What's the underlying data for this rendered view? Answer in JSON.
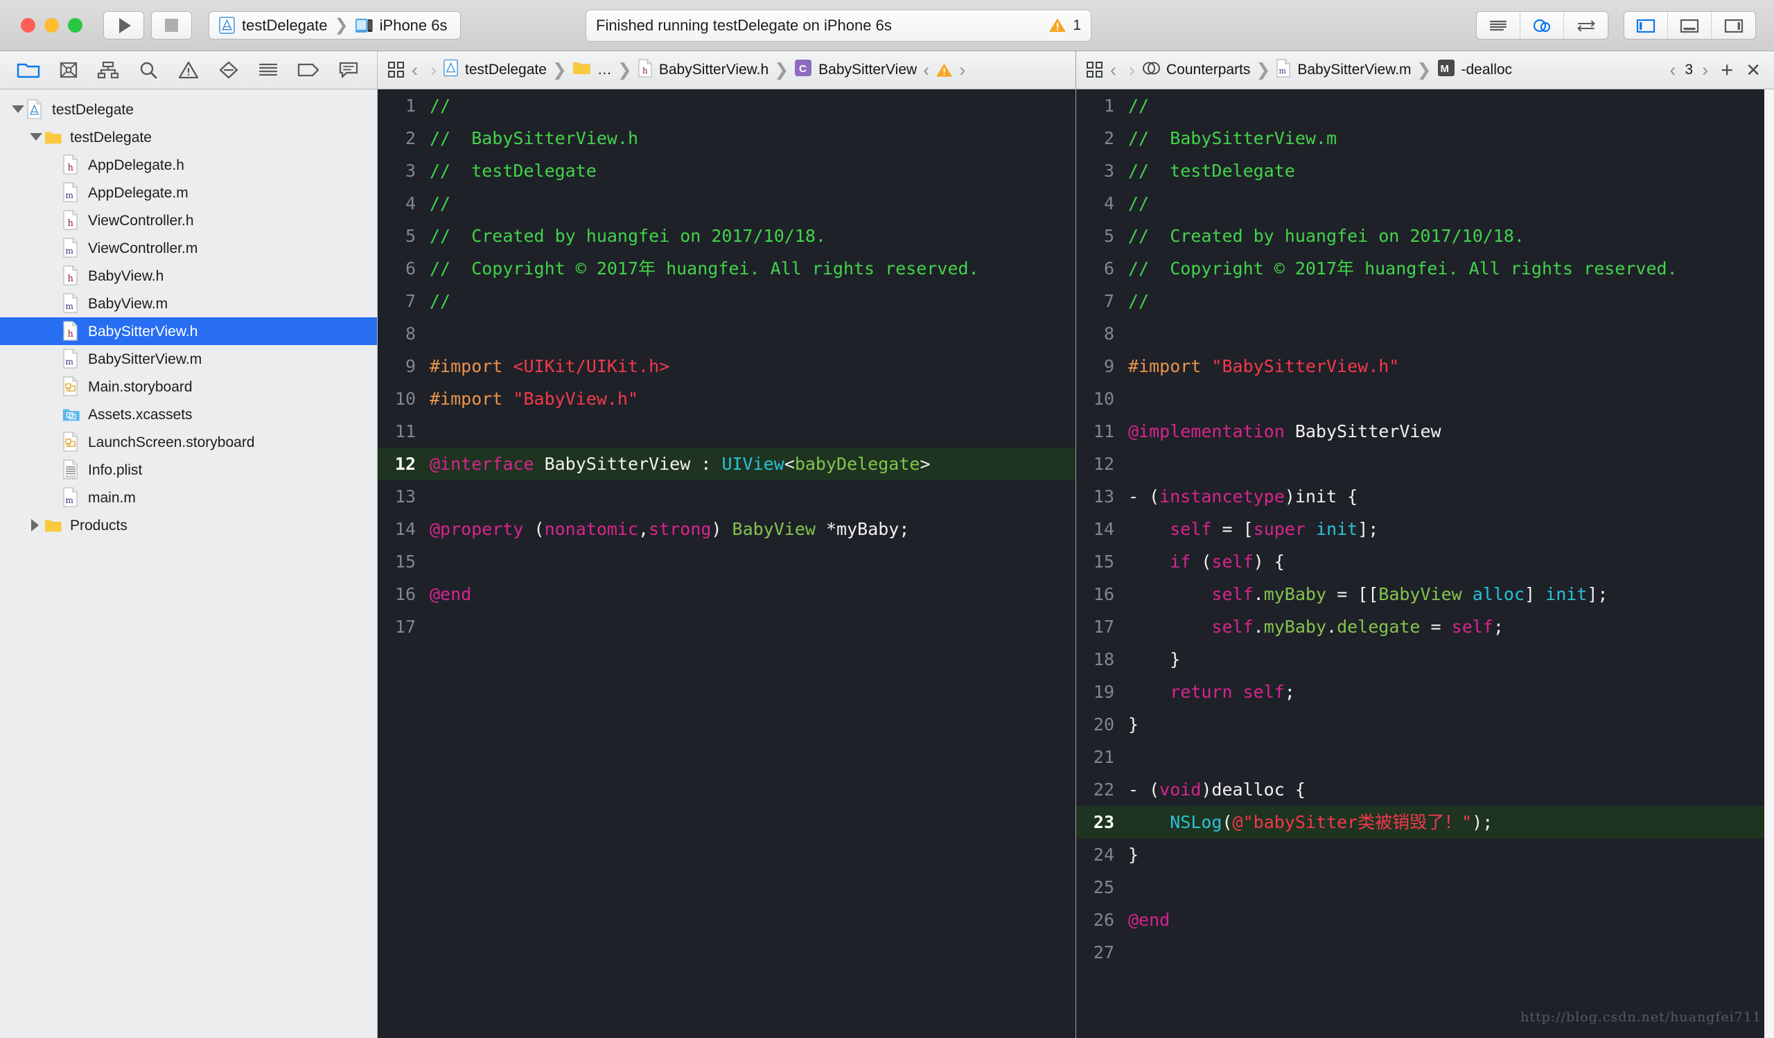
{
  "window": {
    "traffic_lights": [
      "close",
      "minimize",
      "zoom"
    ],
    "run_button": "run",
    "stop_button": "stop",
    "scheme": {
      "project": "testDelegate",
      "destination": "iPhone 6s"
    },
    "status": {
      "message": "Finished running testDelegate on iPhone 6s",
      "warning_count": "1"
    },
    "editor_modes": [
      "standard-editor",
      "assistant-editor",
      "version-editor"
    ],
    "view_toggles": [
      "navigator-toggle",
      "debug-area-toggle",
      "utilities-toggle"
    ]
  },
  "navigator": {
    "tabs": [
      "project-navigator",
      "source-control-navigator",
      "symbol-navigator",
      "find-navigator",
      "issue-navigator",
      "test-navigator",
      "debug-navigator",
      "breakpoint-navigator",
      "report-navigator"
    ],
    "tree": [
      {
        "label": "testDelegate",
        "icon": "xcodeproj",
        "indent": 0,
        "twisty": "open",
        "selected": false
      },
      {
        "label": "testDelegate",
        "icon": "folder",
        "indent": 1,
        "twisty": "open",
        "selected": false
      },
      {
        "label": "AppDelegate.h",
        "icon": "header",
        "indent": 2,
        "twisty": "none",
        "selected": false
      },
      {
        "label": "AppDelegate.m",
        "icon": "method",
        "indent": 2,
        "twisty": "none",
        "selected": false
      },
      {
        "label": "ViewController.h",
        "icon": "header",
        "indent": 2,
        "twisty": "none",
        "selected": false
      },
      {
        "label": "ViewController.m",
        "icon": "method",
        "indent": 2,
        "twisty": "none",
        "selected": false
      },
      {
        "label": "BabyView.h",
        "icon": "header",
        "indent": 2,
        "twisty": "none",
        "selected": false
      },
      {
        "label": "BabyView.m",
        "icon": "method",
        "indent": 2,
        "twisty": "none",
        "selected": false
      },
      {
        "label": "BabySitterView.h",
        "icon": "header",
        "indent": 2,
        "twisty": "none",
        "selected": true
      },
      {
        "label": "BabySitterView.m",
        "icon": "method",
        "indent": 2,
        "twisty": "none",
        "selected": false
      },
      {
        "label": "Main.storyboard",
        "icon": "storyboard",
        "indent": 2,
        "twisty": "none",
        "selected": false
      },
      {
        "label": "Assets.xcassets",
        "icon": "xcassets",
        "indent": 2,
        "twisty": "none",
        "selected": false
      },
      {
        "label": "LaunchScreen.storyboard",
        "icon": "storyboard",
        "indent": 2,
        "twisty": "none",
        "selected": false
      },
      {
        "label": "Info.plist",
        "icon": "plist",
        "indent": 2,
        "twisty": "none",
        "selected": false
      },
      {
        "label": "main.m",
        "icon": "method",
        "indent": 2,
        "twisty": "none",
        "selected": false
      },
      {
        "label": "Products",
        "icon": "folder",
        "indent": 1,
        "twisty": "closed",
        "selected": false
      }
    ]
  },
  "left_editor": {
    "jumpbar": {
      "related_items": "related-items",
      "back": "‹",
      "forward": "›",
      "crumbs": [
        {
          "label": "testDelegate",
          "icon": "xcodeproj"
        },
        {
          "label": "…",
          "icon": "folder"
        },
        {
          "label": "BabySitterView.h",
          "icon": "header"
        },
        {
          "label": "BabySitterView",
          "icon": "class-c"
        }
      ],
      "issue_prev": "‹",
      "issue_next": "›",
      "issue_badge": "warning"
    },
    "lines": [
      {
        "n": "1",
        "hl": false,
        "spans": [
          {
            "t": "//",
            "c": "cmt"
          }
        ]
      },
      {
        "n": "2",
        "hl": false,
        "spans": [
          {
            "t": "//  BabySitterView.h",
            "c": "cmt"
          }
        ]
      },
      {
        "n": "3",
        "hl": false,
        "spans": [
          {
            "t": "//  testDelegate",
            "c": "cmt"
          }
        ]
      },
      {
        "n": "4",
        "hl": false,
        "spans": [
          {
            "t": "//",
            "c": "cmt"
          }
        ]
      },
      {
        "n": "5",
        "hl": false,
        "spans": [
          {
            "t": "//  Created by huangfei on 2017/10/18.",
            "c": "cmt"
          }
        ]
      },
      {
        "n": "6",
        "hl": false,
        "spans": [
          {
            "t": "//  Copyright © 2017年 huangfei. All rights reserved.",
            "c": "cmt"
          }
        ]
      },
      {
        "n": "7",
        "hl": false,
        "spans": [
          {
            "t": "//",
            "c": "cmt"
          }
        ]
      },
      {
        "n": "8",
        "hl": false,
        "spans": [
          {
            "t": "",
            "c": "pln"
          }
        ]
      },
      {
        "n": "9",
        "hl": false,
        "spans": [
          {
            "t": "#import ",
            "c": "pre"
          },
          {
            "t": "<UIKit/UIKit.h>",
            "c": "str"
          }
        ]
      },
      {
        "n": "10",
        "hl": false,
        "spans": [
          {
            "t": "#import ",
            "c": "pre"
          },
          {
            "t": "\"BabyView.h\"",
            "c": "str"
          }
        ]
      },
      {
        "n": "11",
        "hl": false,
        "spans": [
          {
            "t": "",
            "c": "pln"
          }
        ]
      },
      {
        "n": "12",
        "hl": true,
        "spans": [
          {
            "t": "@interface",
            "c": "kw"
          },
          {
            "t": " BabySitterView : ",
            "c": "pln"
          },
          {
            "t": "UIView",
            "c": "typ"
          },
          {
            "t": "<",
            "c": "pln"
          },
          {
            "t": "babyDelegate",
            "c": "grn"
          },
          {
            "t": ">",
            "c": "pln"
          }
        ]
      },
      {
        "n": "13",
        "hl": false,
        "spans": [
          {
            "t": "",
            "c": "pln"
          }
        ]
      },
      {
        "n": "14",
        "hl": false,
        "spans": [
          {
            "t": "@property",
            "c": "kw"
          },
          {
            "t": " (",
            "c": "pln"
          },
          {
            "t": "nonatomic",
            "c": "kw"
          },
          {
            "t": ",",
            "c": "pln"
          },
          {
            "t": "strong",
            "c": "kw"
          },
          {
            "t": ") ",
            "c": "pln"
          },
          {
            "t": "BabyView",
            "c": "grn"
          },
          {
            "t": " *myBaby;",
            "c": "pln"
          }
        ]
      },
      {
        "n": "15",
        "hl": false,
        "spans": [
          {
            "t": "",
            "c": "pln"
          }
        ]
      },
      {
        "n": "16",
        "hl": false,
        "spans": [
          {
            "t": "@end",
            "c": "kw"
          }
        ]
      },
      {
        "n": "17",
        "hl": false,
        "spans": [
          {
            "t": "",
            "c": "pln"
          }
        ]
      }
    ]
  },
  "right_editor": {
    "jumpbar": {
      "related_items": "related-items",
      "back": "‹",
      "forward": "›",
      "crumbs": [
        {
          "label": "Counterparts",
          "icon": "counterparts"
        },
        {
          "label": "BabySitterView.m",
          "icon": "method"
        },
        {
          "label": "-dealloc",
          "icon": "method-m"
        }
      ],
      "page_prev": "‹",
      "page_num": "3",
      "page_next": "›",
      "add_assistant": "+",
      "close_assistant": "✕"
    },
    "lines": [
      {
        "n": "1",
        "hl": false,
        "spans": [
          {
            "t": "//",
            "c": "cmt"
          }
        ]
      },
      {
        "n": "2",
        "hl": false,
        "spans": [
          {
            "t": "//  BabySitterView.m",
            "c": "cmt"
          }
        ]
      },
      {
        "n": "3",
        "hl": false,
        "spans": [
          {
            "t": "//  testDelegate",
            "c": "cmt"
          }
        ]
      },
      {
        "n": "4",
        "hl": false,
        "spans": [
          {
            "t": "//",
            "c": "cmt"
          }
        ]
      },
      {
        "n": "5",
        "hl": false,
        "spans": [
          {
            "t": "//  Created by huangfei on 2017/10/18.",
            "c": "cmt"
          }
        ]
      },
      {
        "n": "6",
        "hl": false,
        "spans": [
          {
            "t": "//  Copyright © 2017年 huangfei. All rights reserved.",
            "c": "cmt"
          }
        ]
      },
      {
        "n": "7",
        "hl": false,
        "spans": [
          {
            "t": "//",
            "c": "cmt"
          }
        ]
      },
      {
        "n": "8",
        "hl": false,
        "spans": [
          {
            "t": "",
            "c": "pln"
          }
        ]
      },
      {
        "n": "9",
        "hl": false,
        "spans": [
          {
            "t": "#import ",
            "c": "pre"
          },
          {
            "t": "\"BabySitterView.h\"",
            "c": "str"
          }
        ]
      },
      {
        "n": "10",
        "hl": false,
        "spans": [
          {
            "t": "",
            "c": "pln"
          }
        ]
      },
      {
        "n": "11",
        "hl": false,
        "spans": [
          {
            "t": "@implementation",
            "c": "kw"
          },
          {
            "t": " BabySitterView",
            "c": "pln"
          }
        ]
      },
      {
        "n": "12",
        "hl": false,
        "spans": [
          {
            "t": "",
            "c": "pln"
          }
        ]
      },
      {
        "n": "13",
        "hl": false,
        "spans": [
          {
            "t": "- (",
            "c": "pln"
          },
          {
            "t": "instancetype",
            "c": "kw"
          },
          {
            "t": ")init {",
            "c": "pln"
          }
        ]
      },
      {
        "n": "14",
        "hl": false,
        "spans": [
          {
            "t": "    ",
            "c": "pln"
          },
          {
            "t": "self",
            "c": "kw"
          },
          {
            "t": " = [",
            "c": "pln"
          },
          {
            "t": "super",
            "c": "kw"
          },
          {
            "t": " ",
            "c": "pln"
          },
          {
            "t": "init",
            "c": "typ"
          },
          {
            "t": "];",
            "c": "pln"
          }
        ]
      },
      {
        "n": "15",
        "hl": false,
        "spans": [
          {
            "t": "    ",
            "c": "pln"
          },
          {
            "t": "if",
            "c": "kw"
          },
          {
            "t": " (",
            "c": "pln"
          },
          {
            "t": "self",
            "c": "kw"
          },
          {
            "t": ") {",
            "c": "pln"
          }
        ]
      },
      {
        "n": "16",
        "hl": false,
        "spans": [
          {
            "t": "        ",
            "c": "pln"
          },
          {
            "t": "self",
            "c": "kw"
          },
          {
            "t": ".",
            "c": "pln"
          },
          {
            "t": "myBaby",
            "c": "grn"
          },
          {
            "t": " = [[",
            "c": "pln"
          },
          {
            "t": "BabyView",
            "c": "grn"
          },
          {
            "t": " ",
            "c": "pln"
          },
          {
            "t": "alloc",
            "c": "typ"
          },
          {
            "t": "] ",
            "c": "pln"
          },
          {
            "t": "init",
            "c": "typ"
          },
          {
            "t": "];",
            "c": "pln"
          }
        ]
      },
      {
        "n": "17",
        "hl": false,
        "spans": [
          {
            "t": "        ",
            "c": "pln"
          },
          {
            "t": "self",
            "c": "kw"
          },
          {
            "t": ".",
            "c": "pln"
          },
          {
            "t": "myBaby",
            "c": "grn"
          },
          {
            "t": ".",
            "c": "pln"
          },
          {
            "t": "delegate",
            "c": "grn"
          },
          {
            "t": " = ",
            "c": "pln"
          },
          {
            "t": "self",
            "c": "kw"
          },
          {
            "t": ";",
            "c": "pln"
          }
        ]
      },
      {
        "n": "18",
        "hl": false,
        "spans": [
          {
            "t": "    }",
            "c": "pln"
          }
        ]
      },
      {
        "n": "19",
        "hl": false,
        "spans": [
          {
            "t": "    ",
            "c": "pln"
          },
          {
            "t": "return self",
            "c": "kw"
          },
          {
            "t": ";",
            "c": "pln"
          }
        ]
      },
      {
        "n": "20",
        "hl": false,
        "spans": [
          {
            "t": "}",
            "c": "pln"
          }
        ]
      },
      {
        "n": "21",
        "hl": false,
        "spans": [
          {
            "t": "",
            "c": "pln"
          }
        ]
      },
      {
        "n": "22",
        "hl": false,
        "spans": [
          {
            "t": "- (",
            "c": "pln"
          },
          {
            "t": "void",
            "c": "kw"
          },
          {
            "t": ")dealloc {",
            "c": "pln"
          }
        ]
      },
      {
        "n": "23",
        "hl": true,
        "spans": [
          {
            "t": "    ",
            "c": "pln"
          },
          {
            "t": "NSLog",
            "c": "typ"
          },
          {
            "t": "(",
            "c": "pln"
          },
          {
            "t": "@\"babySitter类被销毁了！\"",
            "c": "str"
          },
          {
            "t": ");",
            "c": "pln"
          }
        ]
      },
      {
        "n": "24",
        "hl": false,
        "spans": [
          {
            "t": "}",
            "c": "pln"
          }
        ]
      },
      {
        "n": "25",
        "hl": false,
        "spans": [
          {
            "t": "",
            "c": "pln"
          }
        ]
      },
      {
        "n": "26",
        "hl": false,
        "spans": [
          {
            "t": "@end",
            "c": "kw"
          }
        ]
      },
      {
        "n": "27",
        "hl": false,
        "spans": [
          {
            "t": "",
            "c": "pln"
          }
        ]
      }
    ],
    "watermark": "http://blog.csdn.net/huangfei711"
  },
  "colors": {
    "selection_blue": "#276ef3",
    "editor_bg": "#1f2128",
    "highlight_line": "#1e3320",
    "comment_green": "#41d44a",
    "keyword_pink": "#d7258f",
    "string_red": "#f3394c",
    "preprocessor_orange": "#e8944a",
    "type_cyan": "#29c2d8",
    "identifier_green": "#83c44e",
    "warning_amber": "#f5a623"
  }
}
